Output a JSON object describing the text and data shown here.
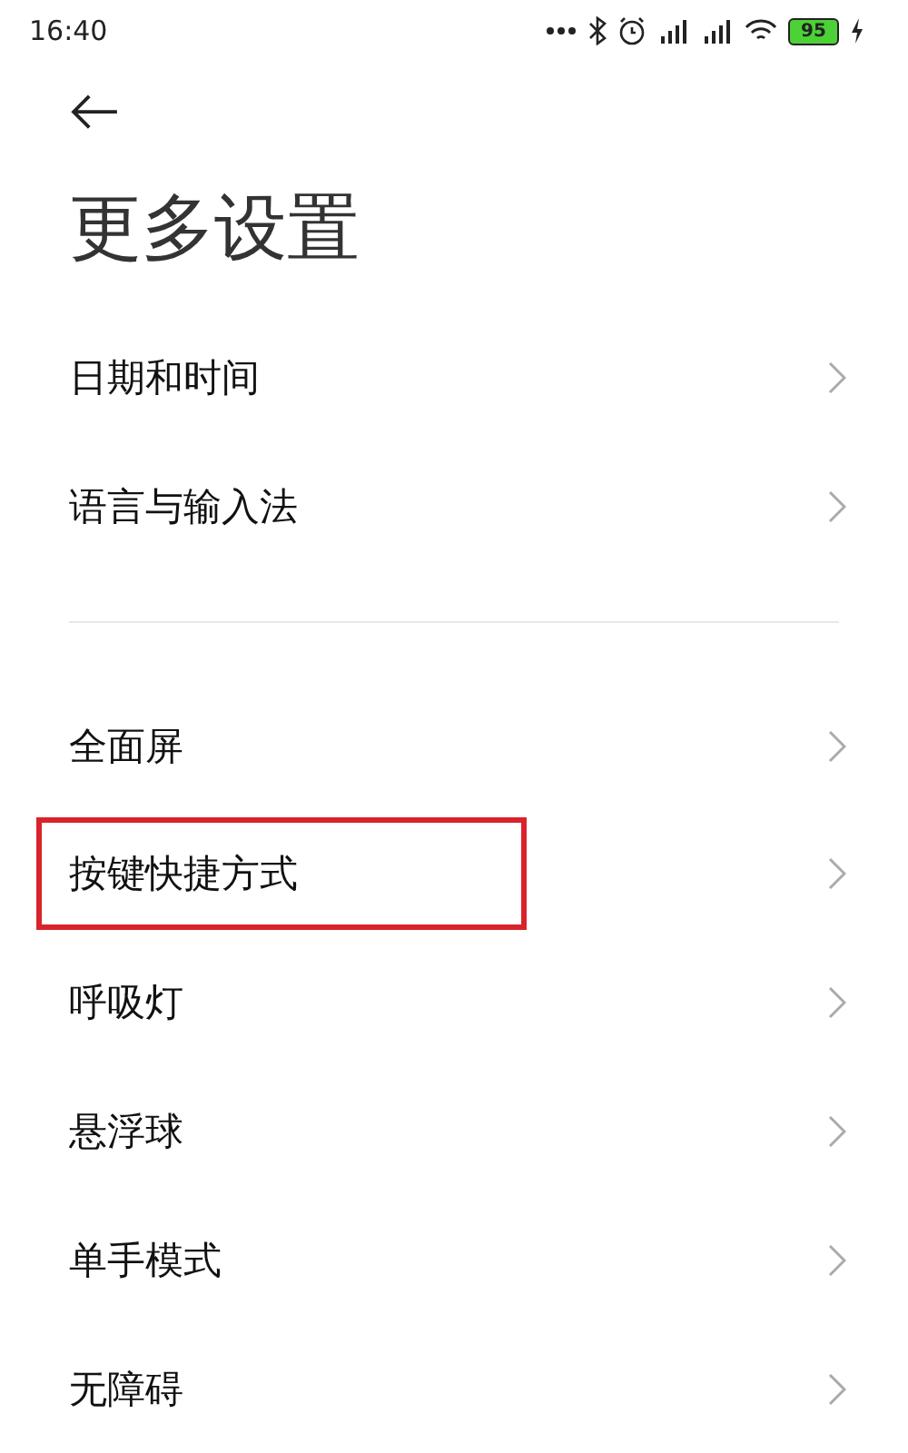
{
  "status_bar": {
    "time": "16:40",
    "battery": "95"
  },
  "page": {
    "title": "更多设置"
  },
  "groups": [
    {
      "items": [
        {
          "label": "日期和时间",
          "highlighted": false
        },
        {
          "label": "语言与输入法",
          "highlighted": false
        }
      ]
    },
    {
      "items": [
        {
          "label": "全面屏",
          "highlighted": false
        },
        {
          "label": "按键快捷方式",
          "highlighted": true
        },
        {
          "label": "呼吸灯",
          "highlighted": false
        },
        {
          "label": "悬浮球",
          "highlighted": false
        },
        {
          "label": "单手模式",
          "highlighted": false
        },
        {
          "label": "无障碍",
          "highlighted": false
        }
      ]
    }
  ]
}
